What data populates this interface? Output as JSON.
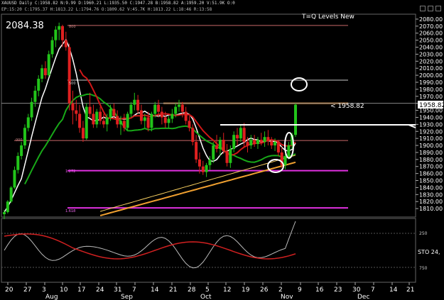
{
  "window": {
    "title_line": "XAUUSD Daily C:1958.82 N:9.99 D:1960.21 L:1935.50 C:1947.28 B:1958.82 A:1959.20 V:51.9K O:0",
    "indicator_line": "EP:15:20 C:1795.37 H:1813.22 L:1794.76 O:1809.62 V:45.7K H:1813.22 L:18:46 R:13:58"
  },
  "chart_labels": {
    "top_value": "2084.38",
    "levels_title": "T=Q Levels New",
    "price_pointer": "< 1958.82",
    "current_price_box": "1958.82",
    "fib_top": "800",
    "fib_500": "500",
    "fib_000": "000",
    "fib_272": "1.272",
    "fib_618": "1.618",
    "sto_label": "STO 24,",
    "sto_250": "250",
    "sto_750": "750"
  },
  "colors": {
    "bull": "#22c51a",
    "bear": "#e02020",
    "ma_white": "#ffffff",
    "ma_green": "#18a818",
    "ma_red": "#d01818",
    "ma_orange": "#f0a030",
    "ma_yellow": "#f8d060",
    "level_orange": "#f09840",
    "level_magenta": "#e030e0"
  },
  "chart_data": {
    "type": "candlestick",
    "symbol": "XAUUSD",
    "timeframe": "Daily",
    "price_axis": {
      "range": [
        1800,
        2085
      ],
      "ticks": [
        2080,
        2070,
        2060,
        2050,
        2040,
        2030,
        2020,
        2010,
        2000,
        1990,
        1980,
        1970,
        1960,
        1950,
        1940,
        1930,
        1920,
        1910,
        1900,
        1890,
        1880,
        1870,
        1860,
        1850,
        1840,
        1830,
        1820,
        1810
      ]
    },
    "time_axis": {
      "ticks": [
        "20",
        "27",
        "3",
        "10",
        "17",
        "24",
        "31",
        "7",
        "14",
        "21",
        "28",
        "5",
        "12",
        "19",
        "26",
        "2",
        "9",
        "16",
        "23",
        "30",
        "7",
        "14",
        "21"
      ],
      "months": [
        "Aug",
        "Sep",
        "Oct",
        "Nov",
        "Dec"
      ]
    },
    "candles_ohlc": [
      [
        1802,
        1808,
        1795,
        1805
      ],
      [
        1805,
        1822,
        1803,
        1820
      ],
      [
        1820,
        1842,
        1818,
        1840
      ],
      [
        1840,
        1870,
        1838,
        1865
      ],
      [
        1865,
        1890,
        1860,
        1885
      ],
      [
        1885,
        1905,
        1880,
        1900
      ],
      [
        1900,
        1930,
        1895,
        1925
      ],
      [
        1925,
        1945,
        1920,
        1940
      ],
      [
        1940,
        1968,
        1935,
        1962
      ],
      [
        1962,
        1985,
        1955,
        1978
      ],
      [
        1978,
        2000,
        1970,
        1995
      ],
      [
        1995,
        2015,
        1990,
        2010
      ],
      [
        2010,
        2020,
        1995,
        2000
      ],
      [
        2000,
        2035,
        1998,
        2030
      ],
      [
        2030,
        2055,
        2025,
        2050
      ],
      [
        2050,
        2070,
        2040,
        2065
      ],
      [
        2065,
        2075,
        2050,
        2070
      ],
      [
        2070,
        2072,
        2040,
        2050
      ],
      [
        2050,
        2062,
        2035,
        2040
      ],
      [
        2040,
        2045,
        1950,
        1960
      ],
      [
        1960,
        1978,
        1930,
        1950
      ],
      [
        1950,
        1965,
        1935,
        1945
      ],
      [
        1945,
        1958,
        1918,
        1925
      ],
      [
        1925,
        1935,
        1905,
        1910
      ],
      [
        1910,
        1960,
        1908,
        1955
      ],
      [
        1955,
        1975,
        1940,
        1945
      ],
      [
        1945,
        1958,
        1925,
        1930
      ],
      [
        1930,
        1952,
        1925,
        1948
      ],
      [
        1948,
        1955,
        1930,
        1935
      ],
      [
        1935,
        1945,
        1925,
        1930
      ],
      [
        1930,
        1945,
        1920,
        1940
      ],
      [
        1940,
        1958,
        1935,
        1952
      ],
      [
        1952,
        1960,
        1938,
        1942
      ],
      [
        1942,
        1950,
        1925,
        1930
      ],
      [
        1930,
        1942,
        1915,
        1935
      ],
      [
        1935,
        1945,
        1920,
        1925
      ],
      [
        1925,
        1948,
        1922,
        1945
      ],
      [
        1945,
        1962,
        1940,
        1958
      ],
      [
        1958,
        1975,
        1950,
        1965
      ],
      [
        1965,
        1972,
        1945,
        1950
      ],
      [
        1950,
        1958,
        1930,
        1935
      ],
      [
        1935,
        1945,
        1925,
        1940
      ],
      [
        1940,
        1948,
        1920,
        1925
      ],
      [
        1925,
        1948,
        1920,
        1945
      ],
      [
        1945,
        1962,
        1940,
        1958
      ],
      [
        1958,
        1965,
        1940,
        1948
      ],
      [
        1948,
        1955,
        1930,
        1940
      ],
      [
        1940,
        1948,
        1925,
        1932
      ],
      [
        1932,
        1942,
        1925,
        1938
      ],
      [
        1938,
        1952,
        1932,
        1945
      ],
      [
        1945,
        1960,
        1940,
        1955
      ],
      [
        1955,
        1965,
        1948,
        1958
      ],
      [
        1958,
        1962,
        1940,
        1948
      ],
      [
        1948,
        1955,
        1930,
        1935
      ],
      [
        1935,
        1942,
        1920,
        1925
      ],
      [
        1925,
        1930,
        1900,
        1905
      ],
      [
        1905,
        1915,
        1875,
        1880
      ],
      [
        1880,
        1890,
        1860,
        1870
      ],
      [
        1870,
        1878,
        1858,
        1862
      ],
      [
        1862,
        1875,
        1855,
        1872
      ],
      [
        1872,
        1885,
        1865,
        1880
      ],
      [
        1880,
        1905,
        1875,
        1900
      ],
      [
        1900,
        1915,
        1890,
        1895
      ],
      [
        1895,
        1912,
        1885,
        1908
      ],
      [
        1908,
        1918,
        1888,
        1892
      ],
      [
        1892,
        1902,
        1870,
        1875
      ],
      [
        1875,
        1900,
        1868,
        1895
      ],
      [
        1895,
        1920,
        1890,
        1915
      ],
      [
        1915,
        1925,
        1900,
        1910
      ],
      [
        1910,
        1930,
        1905,
        1925
      ],
      [
        1925,
        1932,
        1898,
        1905
      ],
      [
        1905,
        1912,
        1890,
        1900
      ],
      [
        1900,
        1915,
        1895,
        1908
      ],
      [
        1908,
        1915,
        1898,
        1902
      ],
      [
        1902,
        1912,
        1895,
        1908
      ],
      [
        1908,
        1918,
        1900,
        1905
      ],
      [
        1905,
        1920,
        1898,
        1912
      ],
      [
        1912,
        1922,
        1900,
        1906
      ],
      [
        1906,
        1912,
        1895,
        1900
      ],
      [
        1900,
        1910,
        1892,
        1905
      ],
      [
        1905,
        1908,
        1885,
        1890
      ],
      [
        1890,
        1898,
        1868,
        1872
      ],
      [
        1872,
        1888,
        1866,
        1885
      ],
      [
        1885,
        1905,
        1880,
        1900
      ],
      [
        1900,
        1918,
        1895,
        1915
      ],
      [
        1915,
        1960,
        1912,
        1958
      ]
    ],
    "levels": [
      {
        "price": 2071,
        "color": "#c86868",
        "label": "800"
      },
      {
        "price": 1993,
        "color": "#cccccc",
        "label": "500"
      },
      {
        "price": 1960,
        "color": "#f09840",
        "label": ""
      },
      {
        "price": 1907,
        "color": "#c86868",
        "label": "000"
      },
      {
        "price": 1864,
        "color": "#e030e0",
        "label": "1.272"
      },
      {
        "price": 1811,
        "color": "#e030e0",
        "label": "1.618"
      }
    ],
    "white_trendline": [
      [
        1930,
        1930
      ]
    ],
    "oscillator": {
      "name": "STO",
      "levels": [
        250,
        750
      ]
    }
  }
}
